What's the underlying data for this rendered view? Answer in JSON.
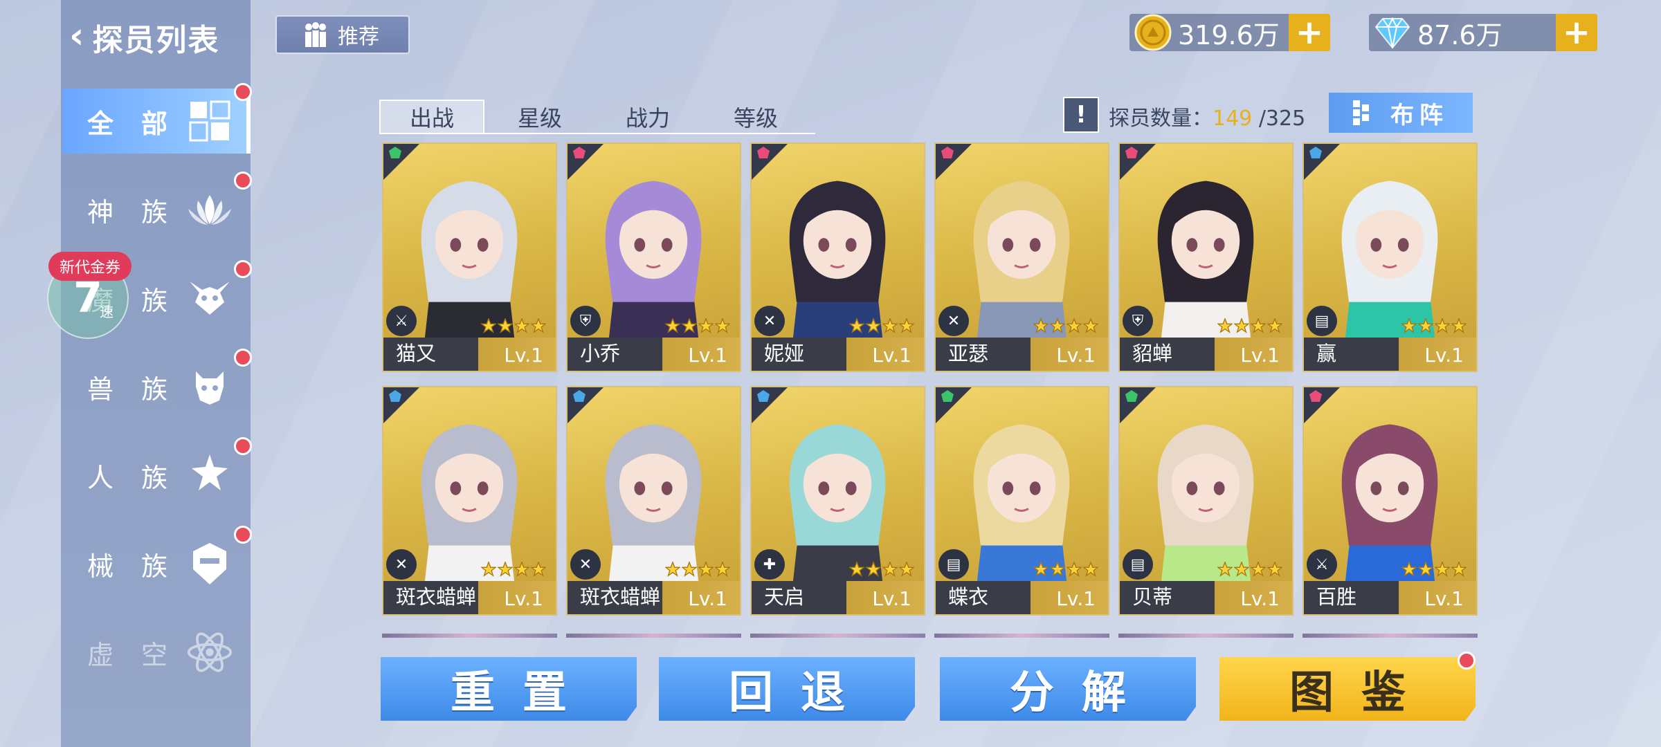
{
  "header": {
    "back_title": "探员列表",
    "recommend_label": "推荐"
  },
  "currencies": [
    {
      "name": "gold-coin",
      "value": "319.6万",
      "plus": "+"
    },
    {
      "name": "diamond",
      "value": "87.6万",
      "plus": "+"
    }
  ],
  "sidebar": {
    "items": [
      {
        "label": "全部",
        "icon": "grid-icon",
        "active": true,
        "badge": true
      },
      {
        "label": "神族",
        "icon": "lotus-icon",
        "badge": true
      },
      {
        "label": "魔族",
        "icon": "demon-icon",
        "badge": true
      },
      {
        "label": "兽族",
        "icon": "beast-icon",
        "badge": true
      },
      {
        "label": "人族",
        "icon": "human-icon",
        "badge": true
      },
      {
        "label": "械族",
        "icon": "mech-icon",
        "badge": true
      },
      {
        "label": "虚空",
        "icon": "void-icon",
        "dimmed": true
      }
    ]
  },
  "overlay": {
    "coupon_badge": "新代金券",
    "speed_number": "7",
    "speed_label": "速"
  },
  "sort_tabs": [
    "出战",
    "星级",
    "战力",
    "等级"
  ],
  "count": {
    "label": "探员数量：",
    "current": "149",
    "total": "/325"
  },
  "info_button": "!",
  "formation_label": "布阵",
  "cards": [
    {
      "name": "猫又",
      "level": "Lv.1",
      "stars": 4,
      "faction_color": "#3cc46a",
      "class_icon": "sword-icon",
      "hair": "#d6dbe8",
      "outfit": "#2b2b33"
    },
    {
      "name": "小乔",
      "level": "Lv.1",
      "stars": 4,
      "faction_color": "#e84c7a",
      "class_icon": "shield-icon",
      "hair": "#a58ad8",
      "outfit": "#3a2f55"
    },
    {
      "name": "妮娅",
      "level": "Lv.1",
      "stars": 4,
      "faction_color": "#e84c7a",
      "class_icon": "axe-icon",
      "hair": "#2e2a3c",
      "outfit": "#2a3f7a"
    },
    {
      "name": "亚瑟",
      "level": "Lv.1",
      "stars": 4,
      "faction_color": "#e84c7a",
      "class_icon": "axe-icon",
      "hair": "#e8cf8a",
      "outfit": "#8a98b8"
    },
    {
      "name": "貂蝉",
      "level": "Lv.1",
      "stars": 4,
      "faction_color": "#e84c7a",
      "class_icon": "shield-icon",
      "hair": "#2a2530",
      "outfit": "#f2f0ee"
    },
    {
      "name": "赢",
      "level": "Lv.1",
      "stars": 4,
      "faction_color": "#4aa8e8",
      "class_icon": "book-icon",
      "hair": "#e8eef2",
      "outfit": "#2ec4a8"
    },
    {
      "name": "斑衣蜡蝉",
      "level": "Lv.1",
      "stars": 4,
      "faction_color": "#4aa8e8",
      "class_icon": "axe-icon",
      "hair": "#b8bccc",
      "outfit": "#f2f2f2"
    },
    {
      "name": "斑衣蜡蝉",
      "level": "Lv.1",
      "stars": 4,
      "faction_color": "#4aa8e8",
      "class_icon": "axe-icon",
      "hair": "#b8bccc",
      "outfit": "#f2f2f2"
    },
    {
      "name": "天启",
      "level": "Lv.1",
      "stars": 4,
      "faction_color": "#4aa8e8",
      "class_icon": "cross-icon",
      "hair": "#9ad8d8",
      "outfit": "#3a3d48"
    },
    {
      "name": "蝶衣",
      "level": "Lv.1",
      "stars": 4,
      "faction_color": "#3cc46a",
      "class_icon": "book-icon",
      "hair": "#ecd9a0",
      "outfit": "#3a78d8"
    },
    {
      "name": "贝蒂",
      "level": "Lv.1",
      "stars": 4,
      "faction_color": "#3cc46a",
      "class_icon": "book-icon",
      "hair": "#e8d8c8",
      "outfit": "#b8e88a"
    },
    {
      "name": "百胜",
      "level": "Lv.1",
      "stars": 4,
      "faction_color": "#e84c7a",
      "class_icon": "sword-icon",
      "hair": "#8a4a6a",
      "outfit": "#2a6ad8"
    }
  ],
  "bottom_buttons": [
    {
      "label": "重置",
      "style": "blue"
    },
    {
      "label": "回退",
      "style": "blue"
    },
    {
      "label": "分解",
      "style": "blue"
    },
    {
      "label": "图鉴",
      "style": "gold",
      "badge": true
    }
  ]
}
